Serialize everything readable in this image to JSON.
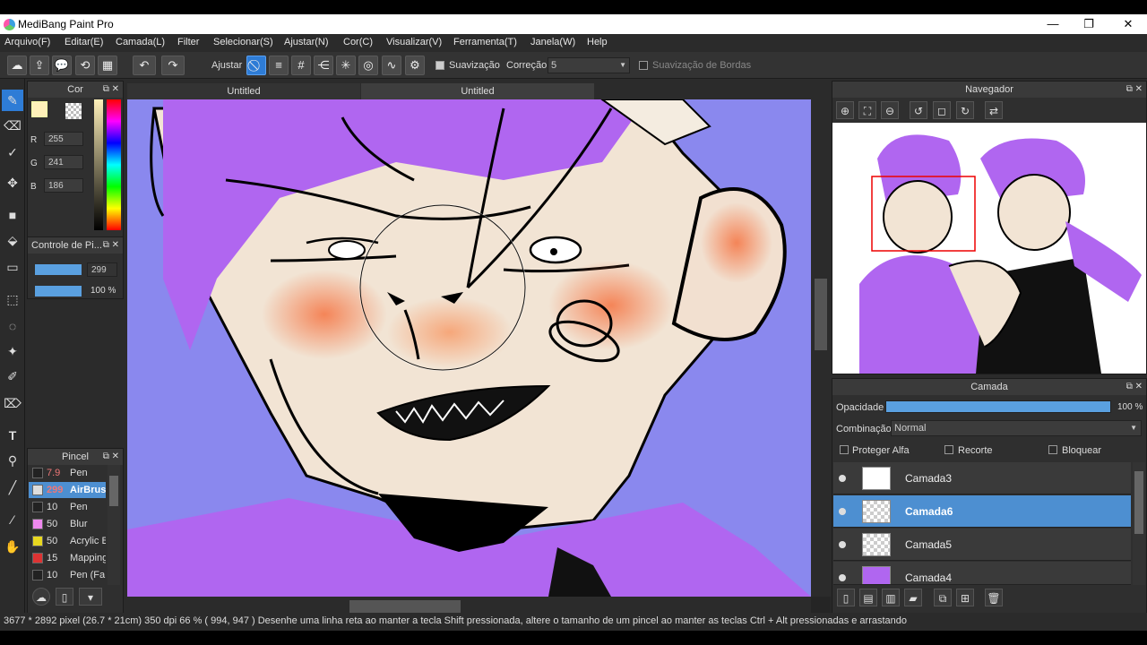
{
  "window": {
    "title": "MediBang Paint Pro",
    "controls": [
      "—",
      "❐",
      "✕"
    ]
  },
  "menu": [
    "Arquivo(F)",
    "Editar(E)",
    "Camada(L)",
    "Filter",
    "Selecionar(S)",
    "Ajustar(N)",
    "Cor(C)",
    "Visualizar(V)",
    "Ferramenta(T)",
    "Janela(W)",
    "Help"
  ],
  "toolbar": {
    "ajustar_label": "Ajustar",
    "suavizacao_label": "Suavização",
    "correcao_label": "Correção",
    "correcao_value": "5",
    "bordas_label": "Suavização de Bordas"
  },
  "tabs": [
    "Untitled",
    "Untitled"
  ],
  "color_panel": {
    "title": "Cor",
    "r_label": "R",
    "r": "255",
    "g_label": "G",
    "g": "241",
    "b_label": "B",
    "b": "186",
    "primary_color": "#fff1ba"
  },
  "brush_control": {
    "title": "Controle de Pi...",
    "size": "299",
    "opacity": "100 %"
  },
  "brush_panel": {
    "title": "Pincel",
    "items": [
      {
        "size": "7.9",
        "name": "Pen",
        "color": "#222222"
      },
      {
        "size": "299",
        "name": "AirBrush",
        "color": "#dddddd"
      },
      {
        "size": "10",
        "name": "Pen",
        "color": "#222222"
      },
      {
        "size": "50",
        "name": "Blur",
        "color": "#ee88ee"
      },
      {
        "size": "50",
        "name": "Acrylic B",
        "color": "#e8d820"
      },
      {
        "size": "15",
        "name": "Mapping",
        "color": "#dd3030"
      },
      {
        "size": "10",
        "name": "Pen (Fa",
        "color": "#222222"
      }
    ]
  },
  "navigator": {
    "title": "Navegador"
  },
  "layer_panel": {
    "title": "Camada",
    "opacity_label": "Opacidade",
    "opacity_value": "100 %",
    "blend_label": "Combinação",
    "blend_value": "Normal",
    "protect_alpha": "Proteger Alfa",
    "clip": "Recorte",
    "lock": "Bloquear",
    "layers": [
      "Camada3",
      "Camada6",
      "Camada5",
      "Camada4"
    ]
  },
  "status": {
    "text": "3677 * 2892 pixel   (26.7 * 21cm)   350 dpi   66 %   ( 994, 947 )   Desenhe uma linha reta ao manter a tecla Shift pressionada, altere o tamanho de um pincel ao manter as teclas Ctrl + Alt pressionadas e arrastando"
  }
}
